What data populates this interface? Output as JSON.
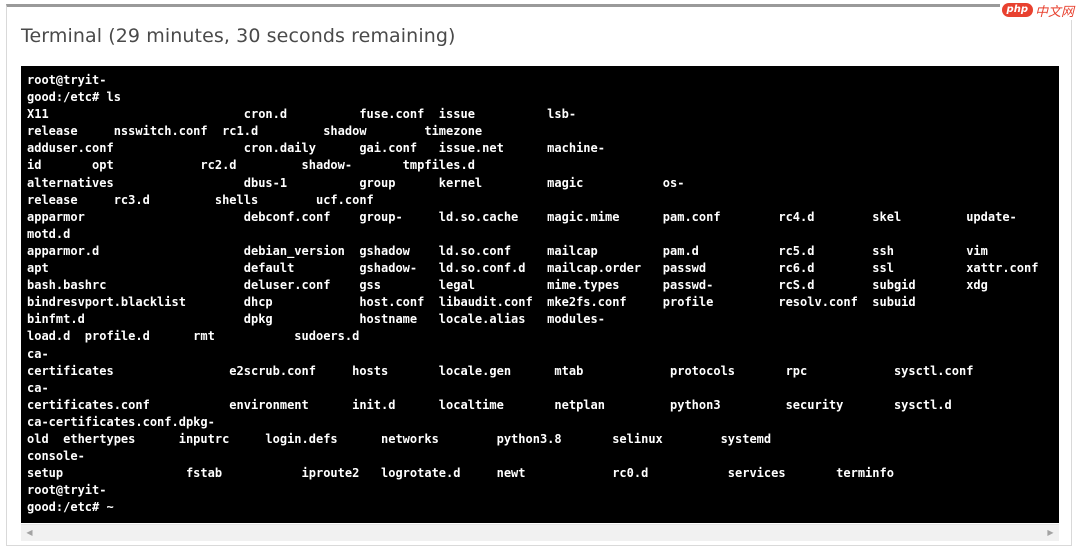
{
  "window": {
    "title": "Terminal (29 minutes, 30 seconds remaining)"
  },
  "watermark": {
    "brand": "php",
    "site": "中文网"
  },
  "terminal": {
    "lines": [
      "root@tryit-",
      "good:/etc# ls",
      "X11                           cron.d          fuse.conf  issue          lsb-",
      "release     nsswitch.conf  rc1.d         shadow        timezone",
      "adduser.conf                  cron.daily      gai.conf   issue.net      machine-",
      "id       opt            rc2.d         shadow-       tmpfiles.d",
      "alternatives                  dbus-1          group      kernel         magic           os-",
      "release     rc3.d         shells        ucf.conf",
      "apparmor                      debconf.conf    group-     ld.so.cache    magic.mime      pam.conf        rc4.d        skel         update-",
      "motd.d",
      "apparmor.d                    debian_version  gshadow    ld.so.conf     mailcap         pam.d           rc5.d        ssh          vim",
      "apt                           default         gshadow-   ld.so.conf.d   mailcap.order   passwd          rc6.d        ssl          xattr.conf",
      "bash.bashrc                   deluser.conf    gss        legal          mime.types      passwd-         rcS.d        subgid       xdg",
      "bindresvport.blacklist        dhcp            host.conf  libaudit.conf  mke2fs.conf     profile         resolv.conf  subuid",
      "binfmt.d                      dpkg            hostname   locale.alias   modules-",
      "load.d  profile.d      rmt           sudoers.d",
      "ca-",
      "certificates                e2scrub.conf     hosts       locale.gen      mtab            protocols       rpc            sysctl.conf",
      "ca-",
      "certificates.conf           environment      init.d      localtime       netplan         python3         security       sysctl.d",
      "ca-certificates.conf.dpkg-",
      "old  ethertypes      inputrc     login.defs      networks        python3.8       selinux        systemd",
      "console-",
      "setup                 fstab           iproute2   logrotate.d     newt            rc0.d           services       terminfo",
      "root@tryit-",
      "good:/etc# ~"
    ]
  },
  "scrollbar": {
    "left_arrow": "◀",
    "right_arrow": "▶"
  }
}
